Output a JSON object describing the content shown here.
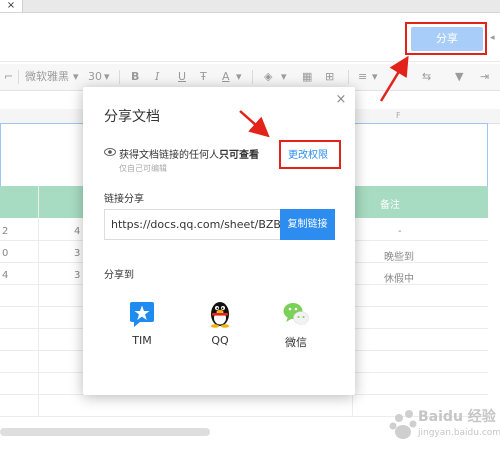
{
  "browser": {
    "tab_close": "×"
  },
  "header": {
    "share_button": "分享"
  },
  "toolbar": {
    "font_name": "微软雅黑",
    "font_size": "30",
    "bold": "B",
    "italic": "I",
    "underline": "U",
    "strike": "Ŧ",
    "font_color": "A"
  },
  "sheet": {
    "column_f": "F",
    "note_header": "备注",
    "rows": [
      {
        "a": "2",
        "b": "4",
        "f": "-"
      },
      {
        "a": "0",
        "b": "3",
        "f": "晚些到"
      },
      {
        "a": "4",
        "b": "3",
        "f": "休假中"
      }
    ]
  },
  "dialog": {
    "title": "分享文档",
    "close": "×",
    "permission_text_prefix": "获得文档链接的任何人",
    "permission_text_bold": "只可查看",
    "permission_sub": "仅自己可编辑",
    "change_permission": "更改权限",
    "link_share_label": "链接分享",
    "url": "https://docs.qq.com/sheet/BZB...",
    "copy_link": "复制链接",
    "share_to_label": "分享到",
    "apps": [
      {
        "name": "TIM",
        "icon": "tim-icon",
        "color": "#1e8bf0"
      },
      {
        "name": "QQ",
        "icon": "qq-penguin-icon",
        "color": "#111111"
      },
      {
        "name": "微信",
        "icon": "wechat-icon",
        "color": "#7bd157"
      }
    ]
  },
  "watermark": {
    "text": "Baidu 经验",
    "sub": "jingyan.baidu.com"
  },
  "colors": {
    "accent": "#2d8cf0",
    "highlight": "#e2231a",
    "green_header": "#a8dcc2"
  }
}
